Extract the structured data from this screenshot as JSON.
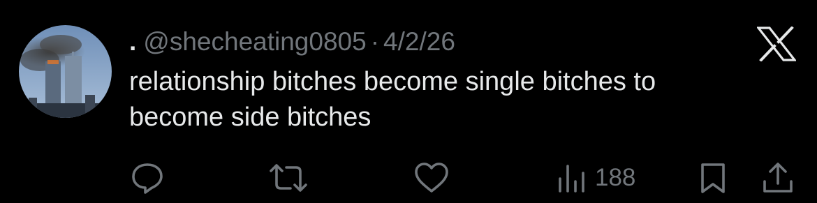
{
  "tweet": {
    "display_name": ".",
    "handle": "@shecheating0805",
    "separator": "·",
    "date": "4/2/26",
    "text_line1": "relationship bitches become single bitches to",
    "text_line2": "become side bitches"
  },
  "actions": {
    "views_count": "188"
  },
  "icons": {
    "reply": "reply-icon",
    "repost": "repost-icon",
    "like": "like-icon",
    "views": "views-icon",
    "bookmark": "bookmark-icon",
    "share": "share-icon",
    "brand": "x-logo-icon"
  },
  "colors": {
    "background": "#000000",
    "text": "#e7e9ea",
    "muted": "#71767b"
  }
}
